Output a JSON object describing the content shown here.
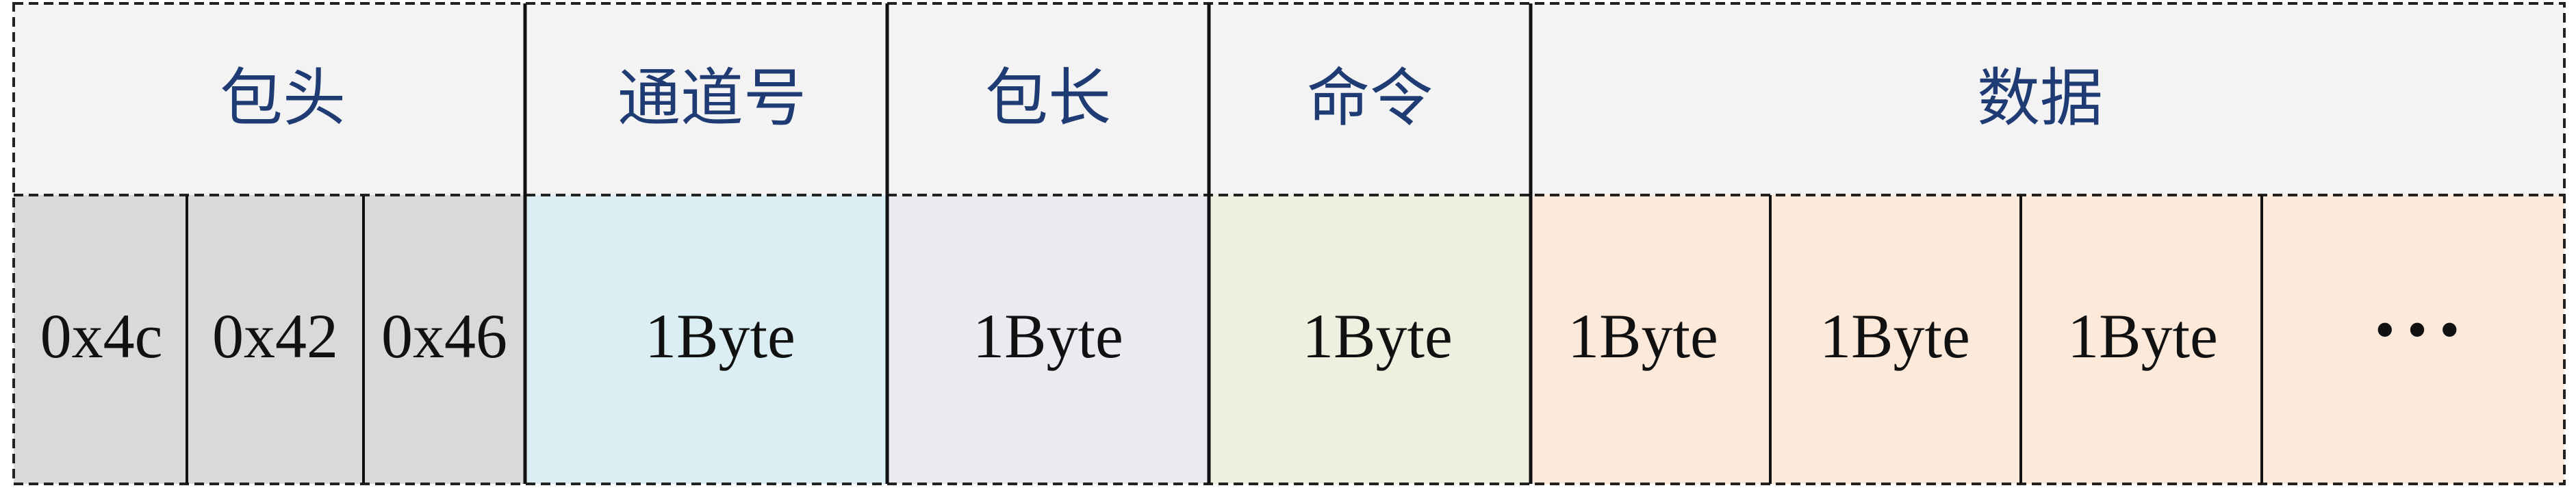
{
  "headers": {
    "packet_head": "包头",
    "channel_no": "通道号",
    "packet_length": "包长",
    "command": "命令",
    "data": "数据"
  },
  "cells": {
    "head_byte_1": "0x4c",
    "head_byte_2": "0x42",
    "head_byte_3": "0x46",
    "channel": "1Byte",
    "length": "1Byte",
    "command": "1Byte",
    "data_1": "1Byte",
    "data_2": "1Byte",
    "data_3": "1Byte",
    "data_more": "•••"
  },
  "colors": {
    "header_bg": "#f3f3f3",
    "header_text": "#1f3b73",
    "head_bg": "#d9d9d9",
    "channel_bg": "#dbeef4",
    "length_bg": "#ece9f1",
    "command_bg": "#ebf1de",
    "data_bg": "#fde9d9"
  }
}
